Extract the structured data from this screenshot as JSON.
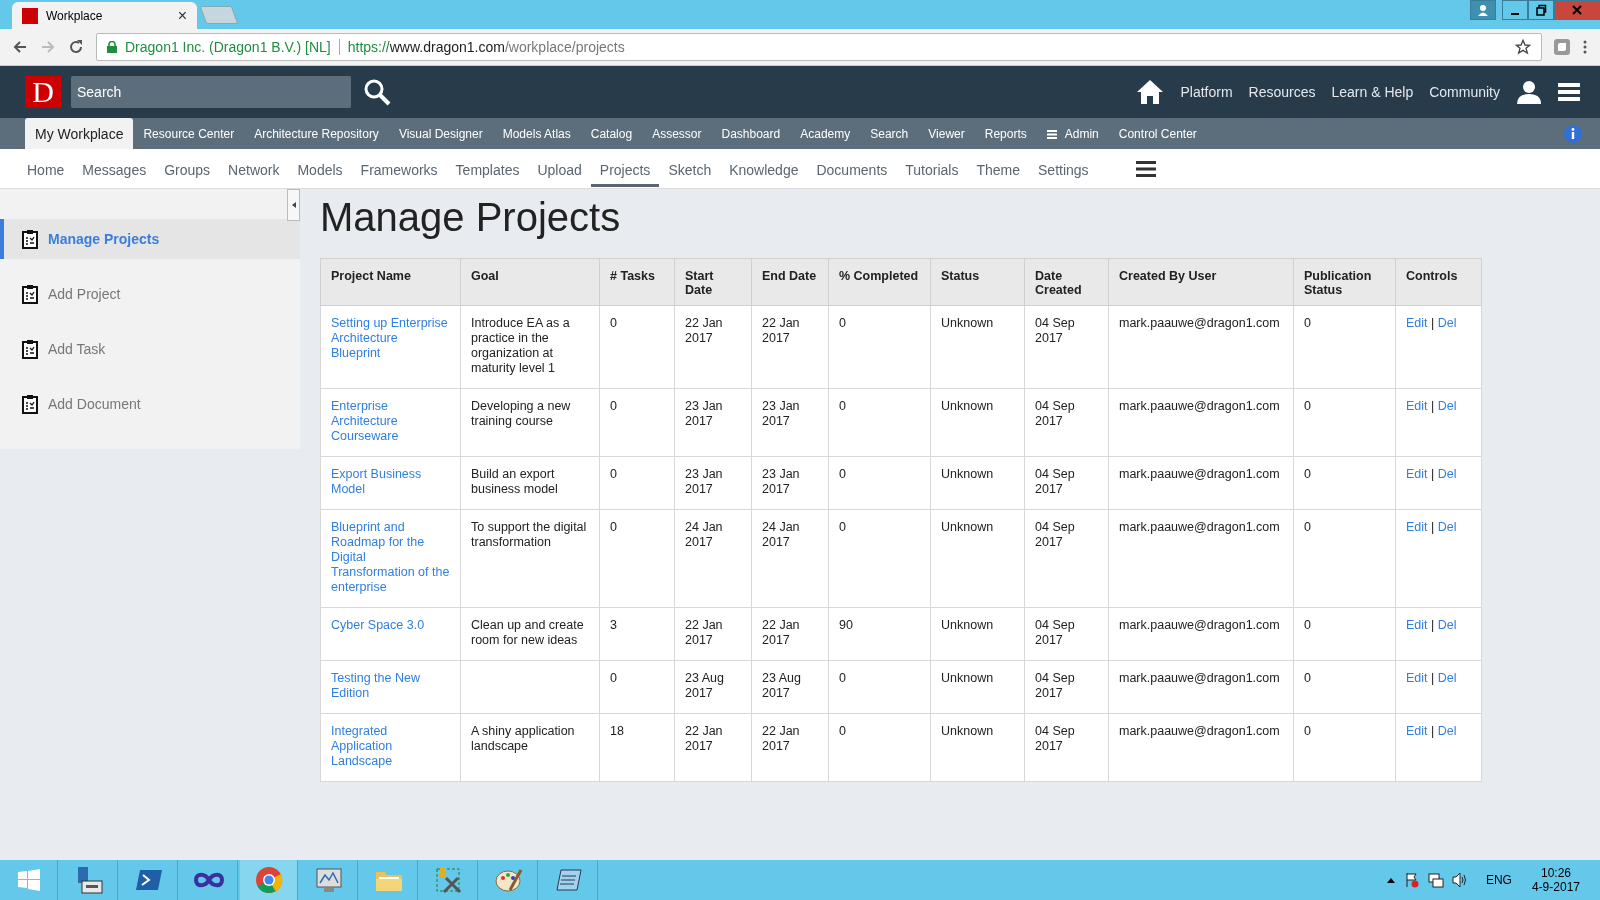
{
  "browser": {
    "tab_title": "Workplace",
    "tab_close": "×",
    "site_identity": "Dragon1 Inc. (Dragon1 B.V.) [NL]",
    "url_scheme": "https://",
    "url_host": "www.dragon1.com",
    "url_path": "/workplace/projects"
  },
  "header": {
    "logo": "D",
    "search_placeholder": "Search",
    "links": [
      "Platform",
      "Resources",
      "Learn & Help",
      "Community"
    ]
  },
  "main_nav": [
    {
      "label": "My Workplace",
      "selected": true,
      "menu": false
    },
    {
      "label": "Resource Center",
      "selected": false,
      "menu": false
    },
    {
      "label": "Architecture Repository",
      "selected": false,
      "menu": false
    },
    {
      "label": "Visual Designer",
      "selected": false,
      "menu": false
    },
    {
      "label": "Models Atlas",
      "selected": false,
      "menu": false
    },
    {
      "label": "Catalog",
      "selected": false,
      "menu": false
    },
    {
      "label": "Assessor",
      "selected": false,
      "menu": false
    },
    {
      "label": "Dashboard",
      "selected": false,
      "menu": false
    },
    {
      "label": "Academy",
      "selected": false,
      "menu": false
    },
    {
      "label": "Search",
      "selected": false,
      "menu": false
    },
    {
      "label": "Viewer",
      "selected": false,
      "menu": false
    },
    {
      "label": "Reports",
      "selected": false,
      "menu": false
    },
    {
      "label": "Admin",
      "selected": false,
      "menu": true
    },
    {
      "label": "Control Center",
      "selected": false,
      "menu": false
    }
  ],
  "sub_nav": [
    {
      "label": "Home",
      "selected": false
    },
    {
      "label": "Messages",
      "selected": false
    },
    {
      "label": "Groups",
      "selected": false
    },
    {
      "label": "Network",
      "selected": false
    },
    {
      "label": "Models",
      "selected": false
    },
    {
      "label": "Frameworks",
      "selected": false
    },
    {
      "label": "Templates",
      "selected": false
    },
    {
      "label": "Upload",
      "selected": false
    },
    {
      "label": "Projects",
      "selected": true
    },
    {
      "label": "Sketch",
      "selected": false
    },
    {
      "label": "Knowledge",
      "selected": false
    },
    {
      "label": "Documents",
      "selected": false
    },
    {
      "label": "Tutorials",
      "selected": false
    },
    {
      "label": "Theme",
      "selected": false
    },
    {
      "label": "Settings",
      "selected": false
    }
  ],
  "sidebar": {
    "items": [
      {
        "label": "Manage Projects",
        "selected": true
      },
      {
        "label": "Add Project",
        "selected": false
      },
      {
        "label": "Add Task",
        "selected": false
      },
      {
        "label": "Add Document",
        "selected": false
      }
    ]
  },
  "page_title": "Manage Projects",
  "table": {
    "columns": [
      "Project Name",
      "Goal",
      "# Tasks",
      "Start Date",
      "End Date",
      "% Completed",
      "Status",
      "Date Created",
      "Created By User",
      "Publication Status",
      "Controls"
    ],
    "rows": [
      {
        "project": "Setting up Enterprise Architecture Blueprint",
        "goal": "Introduce EA as a practice in the organization at maturity level 1",
        "tasks": "0",
        "start": "22 Jan 2017",
        "end": "22 Jan 2017",
        "completed": "0",
        "status": "Unknown",
        "created": "04 Sep 2017",
        "user": "mark.paauwe@dragon1.com",
        "publication": "0",
        "edit": "Edit",
        "sep": "|",
        "del": "Del"
      },
      {
        "project": "Enterprise Architecture Courseware",
        "goal": "Developing a new training course",
        "tasks": "0",
        "start": "23 Jan 2017",
        "end": "23 Jan 2017",
        "completed": "0",
        "status": "Unknown",
        "created": "04 Sep 2017",
        "user": "mark.paauwe@dragon1.com",
        "publication": "0",
        "edit": "Edit",
        "sep": "|",
        "del": "Del"
      },
      {
        "project": "Export Business Model",
        "goal": "Build an export business model",
        "tasks": "0",
        "start": "23 Jan 2017",
        "end": "23 Jan 2017",
        "completed": "0",
        "status": "Unknown",
        "created": "04 Sep 2017",
        "user": "mark.paauwe@dragon1.com",
        "publication": "0",
        "edit": "Edit",
        "sep": "|",
        "del": "Del"
      },
      {
        "project": "Blueprint and Roadmap for the Digital Transformation of the enterprise",
        "goal": "To support the digital transformation",
        "tasks": "0",
        "start": "24 Jan 2017",
        "end": "24 Jan 2017",
        "completed": "0",
        "status": "Unknown",
        "created": "04 Sep 2017",
        "user": "mark.paauwe@dragon1.com",
        "publication": "0",
        "edit": "Edit",
        "sep": "|",
        "del": "Del"
      },
      {
        "project": "Cyber Space 3.0",
        "goal": "Clean up and create room for new ideas",
        "tasks": "3",
        "start": "22 Jan 2017",
        "end": "22 Jan 2017",
        "completed": "90",
        "status": "Unknown",
        "created": "04 Sep 2017",
        "user": "mark.paauwe@dragon1.com",
        "publication": "0",
        "edit": "Edit",
        "sep": "|",
        "del": "Del"
      },
      {
        "project": "Testing the New Edition",
        "tasks": "0",
        "start": "23 Aug 2017",
        "end": "23 Aug 2017",
        "completed": "0",
        "status": "Unknown",
        "created": "04 Sep 2017",
        "user": "mark.paauwe@dragon1.com",
        "publication": "0",
        "edit": "Edit",
        "sep": "|",
        "del": "Del"
      },
      {
        "project": "Integrated Application Landscape",
        "goal": "A shiny application landscape",
        "tasks": "18",
        "start": "22 Jan 2017",
        "end": "22 Jan 2017",
        "completed": "0",
        "status": "Unknown",
        "created": "04 Sep 2017",
        "user": "mark.paauwe@dragon1.com",
        "publication": "0",
        "edit": "Edit",
        "sep": "|",
        "del": "Del"
      }
    ]
  },
  "taskbar": {
    "language": "ENG",
    "time": "10:26",
    "date": "4-9-2017"
  }
}
